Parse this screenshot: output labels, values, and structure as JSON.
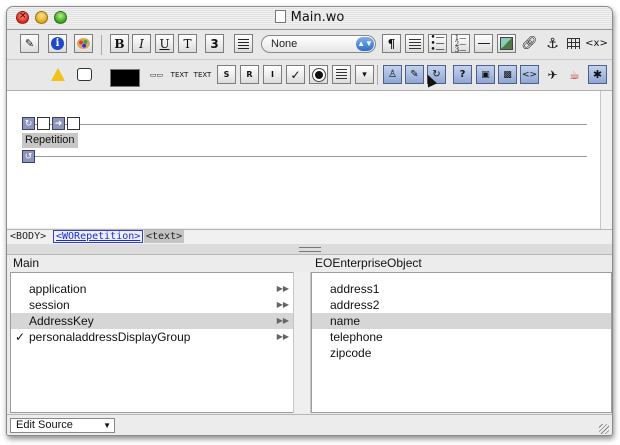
{
  "window": {
    "title": "Main.wo"
  },
  "toolbar1": {
    "bold": "B",
    "italic": "I",
    "underline": "U",
    "typewriter": "T",
    "heading": "3",
    "style_popup": "None",
    "paragraph": "¶"
  },
  "pathbar": {
    "items": [
      "<BODY>",
      "<WORepetition>",
      "<text>"
    ]
  },
  "editor": {
    "repetition_label": "Repetition"
  },
  "left_panel": {
    "header": "Main",
    "items": [
      {
        "label": "application",
        "checked": "",
        "arrow": "▶▶"
      },
      {
        "label": "session",
        "checked": "",
        "arrow": "▶▶"
      },
      {
        "label": "AddressKey",
        "checked": "",
        "arrow": "▶▶"
      },
      {
        "label": "personaladdressDisplayGroup",
        "checked": "✓",
        "arrow": "▶▶"
      }
    ],
    "selected_index": 2
  },
  "right_panel": {
    "header": "EOEnterpriseObject",
    "items": [
      "address1",
      "address2",
      "name",
      "telephone",
      "zipcode"
    ],
    "selected_index": 2
  },
  "footer": {
    "mode_popup": "Edit Source"
  }
}
